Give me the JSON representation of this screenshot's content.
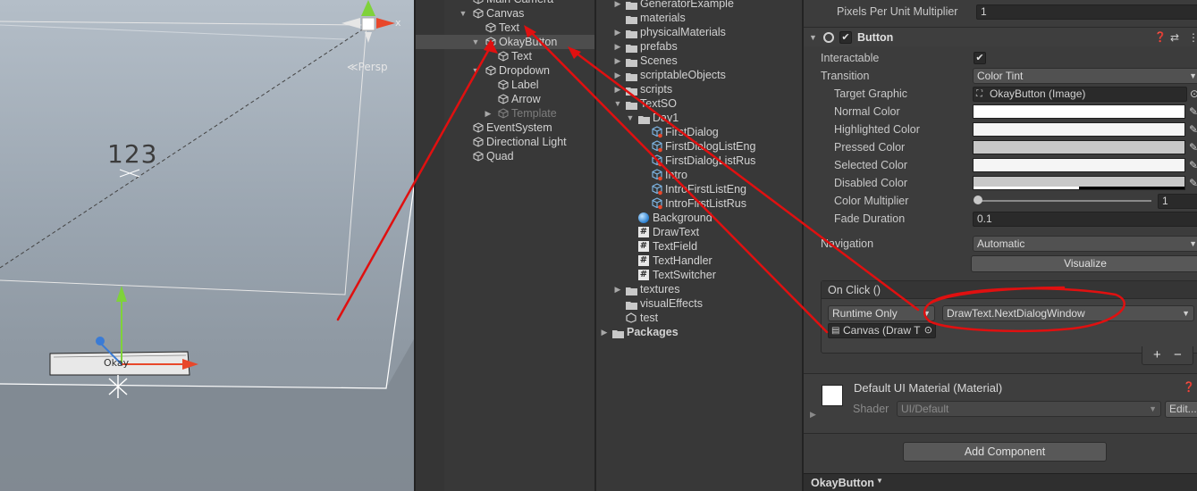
{
  "scene": {
    "persp_label": "≪Persp",
    "canvas_text": "123",
    "button_text": "Okay"
  },
  "hierarchy": {
    "items": [
      {
        "label": "Main Camera",
        "depth": 0,
        "arrow": "",
        "selected": false,
        "disabled": false
      },
      {
        "label": "Canvas",
        "depth": 0,
        "arrow": "▼",
        "selected": false,
        "disabled": false
      },
      {
        "label": "Text",
        "depth": 1,
        "arrow": "",
        "selected": false,
        "disabled": false
      },
      {
        "label": "OkayButton",
        "depth": 1,
        "arrow": "▼",
        "selected": true,
        "disabled": false
      },
      {
        "label": "Text",
        "depth": 2,
        "arrow": "",
        "selected": false,
        "disabled": false
      },
      {
        "label": "Dropdown",
        "depth": 1,
        "arrow": "▼",
        "selected": false,
        "disabled": false
      },
      {
        "label": "Label",
        "depth": 2,
        "arrow": "",
        "selected": false,
        "disabled": false
      },
      {
        "label": "Arrow",
        "depth": 2,
        "arrow": "",
        "selected": false,
        "disabled": false
      },
      {
        "label": "Template",
        "depth": 2,
        "arrow": "▶",
        "selected": false,
        "disabled": true
      },
      {
        "label": "EventSystem",
        "depth": 0,
        "arrow": "",
        "selected": false,
        "disabled": false
      },
      {
        "label": "Directional Light",
        "depth": 0,
        "arrow": "",
        "selected": false,
        "disabled": false
      },
      {
        "label": "Quad",
        "depth": 0,
        "arrow": "",
        "selected": false,
        "disabled": false
      }
    ]
  },
  "project": {
    "items": [
      {
        "label": "GeneratorExample",
        "kind": "folder",
        "depth": 0,
        "arrow": "▶"
      },
      {
        "label": "materials",
        "kind": "folder",
        "depth": 0,
        "arrow": ""
      },
      {
        "label": "physicalMaterials",
        "kind": "folder",
        "depth": 0,
        "arrow": "▶"
      },
      {
        "label": "prefabs",
        "kind": "folder",
        "depth": 0,
        "arrow": "▶"
      },
      {
        "label": "Scenes",
        "kind": "folder",
        "depth": 0,
        "arrow": "▶"
      },
      {
        "label": "scriptableObjects",
        "kind": "folder",
        "depth": 0,
        "arrow": "▶"
      },
      {
        "label": "scripts",
        "kind": "folder",
        "depth": 0,
        "arrow": "▶"
      },
      {
        "label": "TextSO",
        "kind": "folder",
        "depth": 0,
        "arrow": "▼"
      },
      {
        "label": "Day1",
        "kind": "folder",
        "depth": 1,
        "arrow": "▼"
      },
      {
        "label": "FirstDialog",
        "kind": "asset",
        "depth": 2,
        "arrow": ""
      },
      {
        "label": "FirstDialogListEng",
        "kind": "asset",
        "depth": 2,
        "arrow": ""
      },
      {
        "label": "FirstDialogListRus",
        "kind": "asset",
        "depth": 2,
        "arrow": ""
      },
      {
        "label": "Intro",
        "kind": "asset",
        "depth": 2,
        "arrow": ""
      },
      {
        "label": "IntroFirstListEng",
        "kind": "asset",
        "depth": 2,
        "arrow": ""
      },
      {
        "label": "IntroFirstListRus",
        "kind": "asset",
        "depth": 2,
        "arrow": ""
      },
      {
        "label": "Background",
        "kind": "sphere",
        "depth": 1,
        "arrow": ""
      },
      {
        "label": "DrawText",
        "kind": "script",
        "depth": 1,
        "arrow": ""
      },
      {
        "label": "TextField",
        "kind": "script",
        "depth": 1,
        "arrow": ""
      },
      {
        "label": "TextHandler",
        "kind": "script",
        "depth": 1,
        "arrow": ""
      },
      {
        "label": "TextSwitcher",
        "kind": "script",
        "depth": 1,
        "arrow": ""
      },
      {
        "label": "textures",
        "kind": "folder",
        "depth": 0,
        "arrow": "▶"
      },
      {
        "label": "visualEffects",
        "kind": "folder",
        "depth": 0,
        "arrow": ""
      },
      {
        "label": "test",
        "kind": "unity",
        "depth": 0,
        "arrow": ""
      },
      {
        "label": "Packages",
        "kind": "folder",
        "depth": -1,
        "arrow": "▶"
      }
    ]
  },
  "inspector": {
    "pixels_per_unit_label": "Pixels Per Unit Multiplier",
    "pixels_per_unit_value": "1",
    "component_title": "Button",
    "interactable_label": "Interactable",
    "interactable_checked": "✔",
    "transition_label": "Transition",
    "transition_value": "Color Tint",
    "target_graphic_label": "Target Graphic",
    "target_graphic_value": "OkayButton (Image)",
    "colors": [
      {
        "label": "Normal Color",
        "hex": "#ffffff"
      },
      {
        "label": "Highlighted Color",
        "hex": "#f5f5f5"
      },
      {
        "label": "Pressed Color",
        "hex": "#c8c8c8"
      },
      {
        "label": "Selected Color",
        "hex": "#f5f5f5"
      },
      {
        "label": "Disabled Color",
        "hex": "#c8c8c8"
      }
    ],
    "color_multiplier_label": "Color Multiplier",
    "color_multiplier_value": "1",
    "color_multiplier_fraction": 0.0,
    "fade_duration_label": "Fade Duration",
    "fade_duration_value": "0.1",
    "navigation_label": "Navigation",
    "navigation_value": "Automatic",
    "visualize_label": "Visualize",
    "onclick_title": "On Click ()",
    "runtime_value": "Runtime Only",
    "function_value": "DrawText.NextDialogWindow",
    "object_value": "Canvas (Draw T",
    "plus_label": "+",
    "minus_label": "−",
    "material_title": "Default UI Material (Material)",
    "shader_label": "Shader",
    "shader_value": "UI/Default",
    "edit_label": "Edit...",
    "add_component_label": "Add Component",
    "footer_label": "OkayButton"
  },
  "colors": {
    "annotation_red": "#e01010",
    "gizmo_green": "#7fd23a",
    "gizmo_red": "#e8472a",
    "gizmo_blue": "#3a7bd5"
  }
}
